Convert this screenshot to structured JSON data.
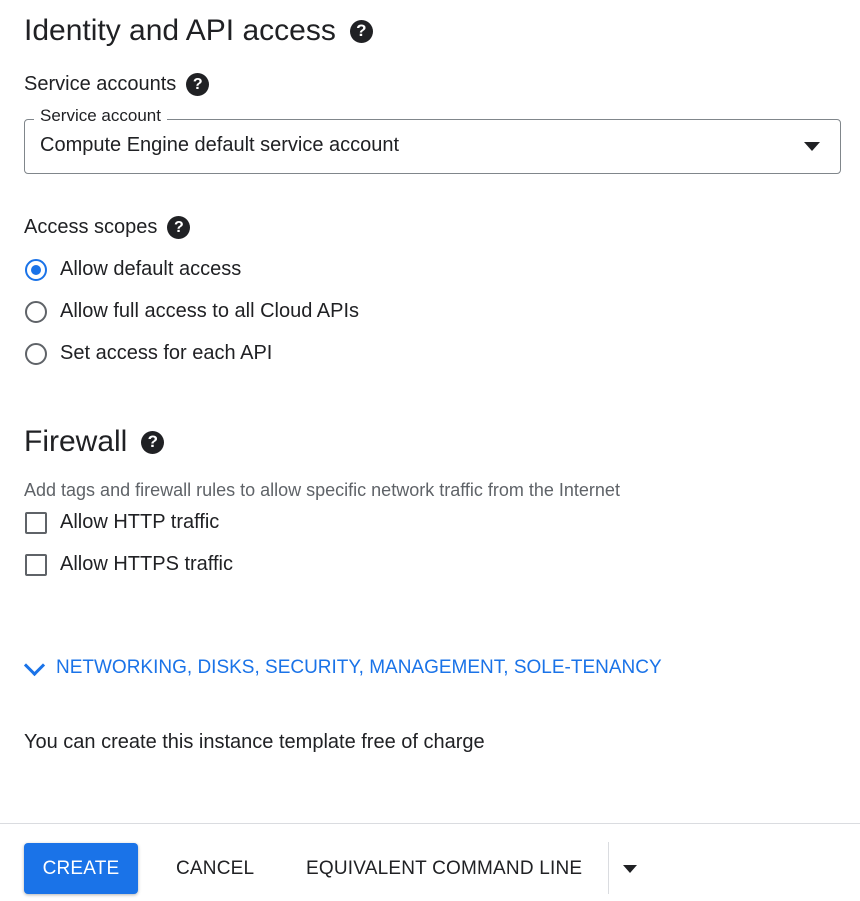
{
  "identity": {
    "title": "Identity and API access",
    "service_accounts_heading": "Service accounts",
    "service_account_label": "Service account",
    "service_account_value": "Compute Engine default service account",
    "access_scopes_heading": "Access scopes",
    "scopes": [
      {
        "label": "Allow default access",
        "selected": true
      },
      {
        "label": "Allow full access to all Cloud APIs",
        "selected": false
      },
      {
        "label": "Set access for each API",
        "selected": false
      }
    ]
  },
  "firewall": {
    "title": "Firewall",
    "description": "Add tags and firewall rules to allow specific network traffic from the Internet",
    "options": [
      {
        "label": "Allow HTTP traffic",
        "checked": false
      },
      {
        "label": "Allow HTTPS traffic",
        "checked": false
      }
    ]
  },
  "advanced": {
    "label": "NETWORKING, DISKS, SECURITY, MANAGEMENT, SOLE-TENANCY"
  },
  "pricing_note": "You can create this instance template free of charge",
  "footer": {
    "create_label": "CREATE",
    "cancel_label": "CANCEL",
    "command_line_label": "EQUIVALENT COMMAND LINE"
  },
  "help_glyph": "?",
  "icons": {
    "help": "help-circle-icon",
    "dropdown": "arrow-drop-down-icon",
    "expand": "chevron-down-icon"
  },
  "colors": {
    "accent": "#1a73e8",
    "text": "#202124",
    "secondary_text": "#5f6368",
    "divider": "#dadce0"
  }
}
